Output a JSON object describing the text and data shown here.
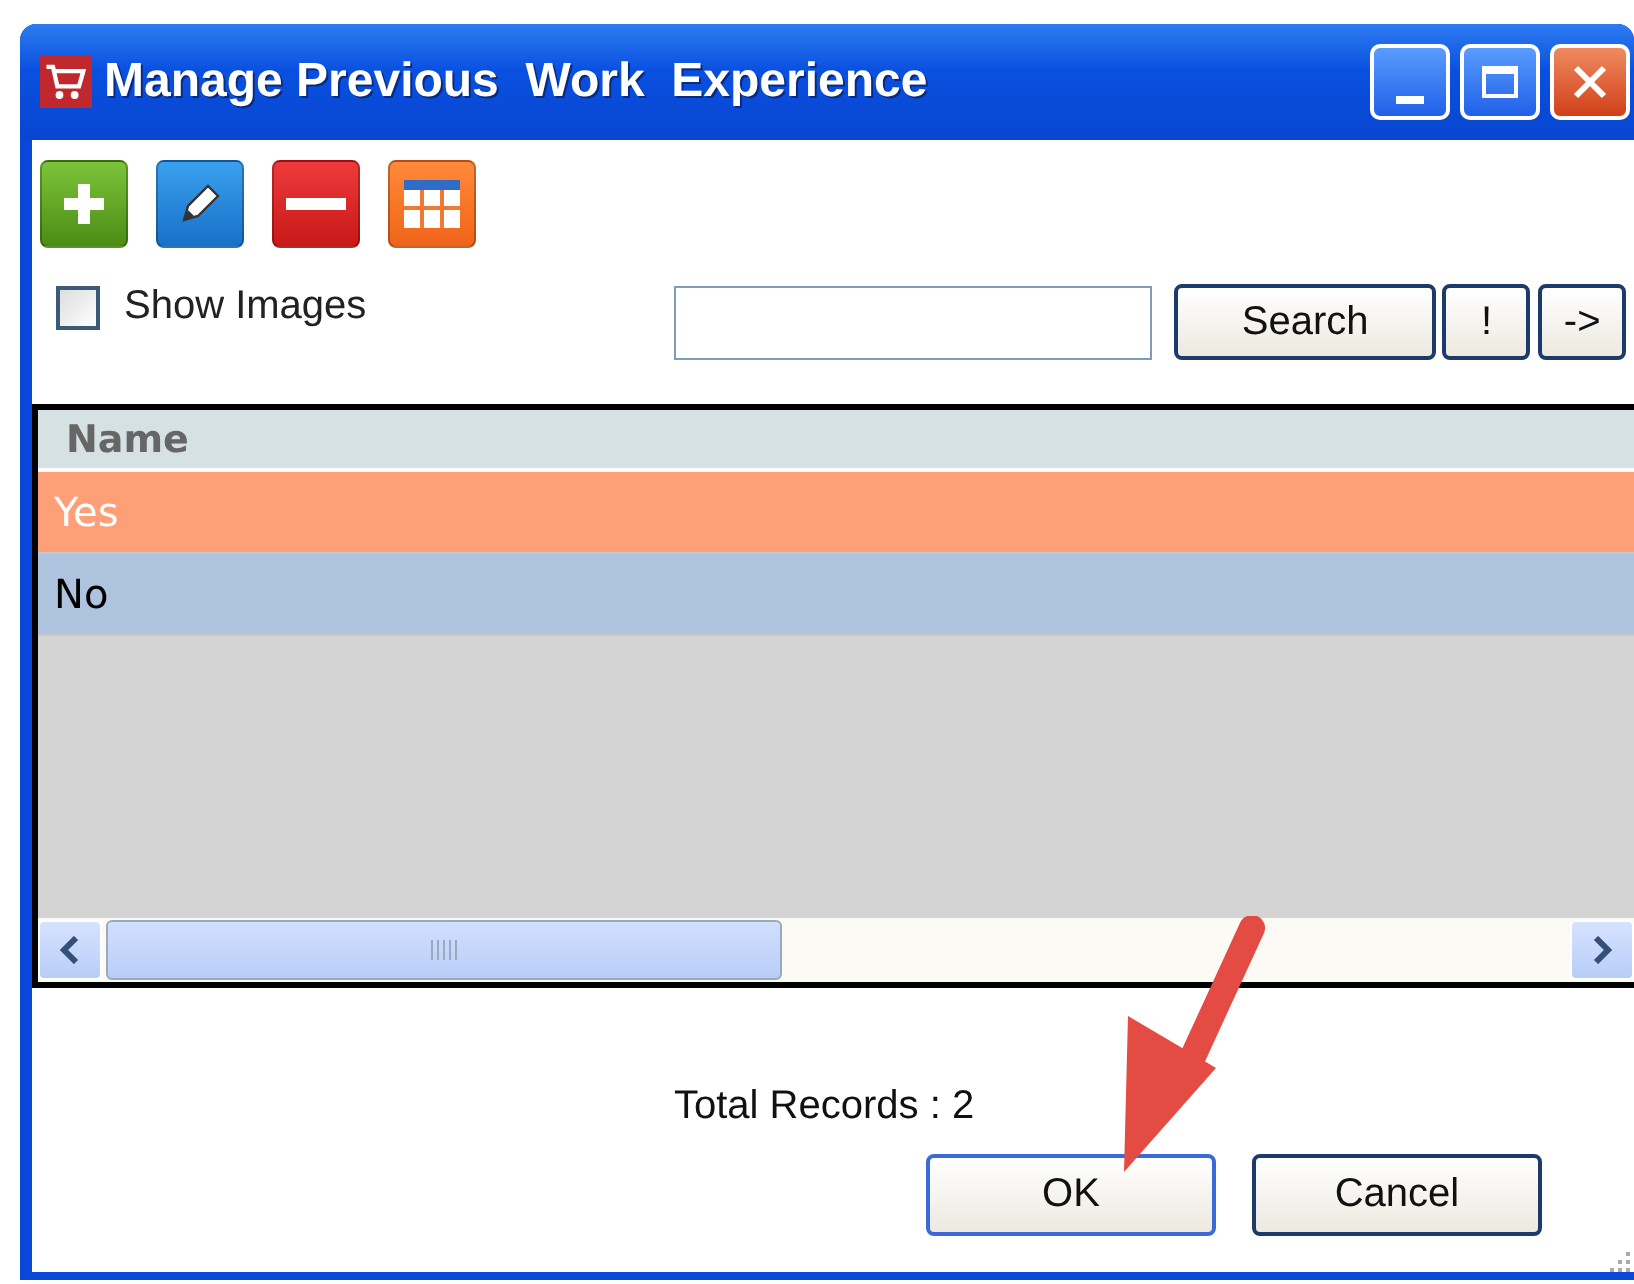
{
  "window": {
    "title": "Manage Previous  Work  Experience"
  },
  "toolbar": {
    "buttons": [
      {
        "kind": "add"
      },
      {
        "kind": "edit"
      },
      {
        "kind": "delete"
      },
      {
        "kind": "grid"
      }
    ]
  },
  "show_images": {
    "label": "Show Images",
    "checked": false
  },
  "search": {
    "button": "Search",
    "extra_buttons": [
      "!",
      "->"
    ]
  },
  "table": {
    "columns": [
      "Name"
    ],
    "rows": [
      {
        "name": "Yes",
        "selected": true
      },
      {
        "name": "No",
        "selected": false
      }
    ]
  },
  "total_records": "Total Records : 2",
  "buttons": [
    "OK",
    "Cancel"
  ]
}
